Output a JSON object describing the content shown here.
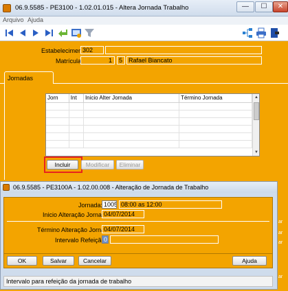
{
  "window": {
    "title": "06.9.5585 - PE3100 - 1.02.01.015 - Altera Jornada Trabalho",
    "minimize": "—",
    "maximize": "☐",
    "close": "✕"
  },
  "menu": [
    "Arquivo",
    "Ajuda"
  ],
  "toolbar": {
    "icons_left": [
      "first-record-icon",
      "previous-record-icon",
      "next-record-icon",
      "last-record-icon",
      "return-icon",
      "view-icon",
      "filter-icon"
    ],
    "icons_right": [
      "hierarchy-icon",
      "print-icon",
      "exit-icon"
    ]
  },
  "header": {
    "estabelecimento_label": "Estabelecimento:",
    "estabelecimento_value": "302",
    "matricula_label": "Matrícula:",
    "matricula_value": "1",
    "matricula_digit": "5",
    "matricula_name": "Rafael Biancato"
  },
  "tab": {
    "label": "Jornadas"
  },
  "grid": {
    "columns": [
      "Jorn",
      "Int",
      "Inicio Alter Jornada",
      "Término Jornada"
    ],
    "rows": 6
  },
  "buttons": {
    "incluir": "Incluir",
    "modificar": "Modificar",
    "eliminar": "Eliminar"
  },
  "dialog": {
    "title": "06.9.5585 - PE3100A - 1.02.00.008 - Alteração de Jornada de Trabalho",
    "jornada_label": "Jornada:",
    "jornada_value": "1005",
    "jornada_desc": "08:00 as 12:00",
    "inicio_label": "Inicio Alteração Jornada:",
    "inicio_value": "04/07/2014",
    "termino_label": "Término Alteração Jornada:",
    "termino_value": "04/07/2014",
    "intervalo_label": "Intervalo Refeição:",
    "intervalo_value": "0",
    "ok": "OK",
    "salvar": "Salvar",
    "cancelar": "Cancelar",
    "ajuda": "Ajuda",
    "status": "Intervalo para refeição da jornada de trabalho"
  },
  "colors": {
    "orange": "#f3a400",
    "highlight_red": "#e8231d"
  }
}
